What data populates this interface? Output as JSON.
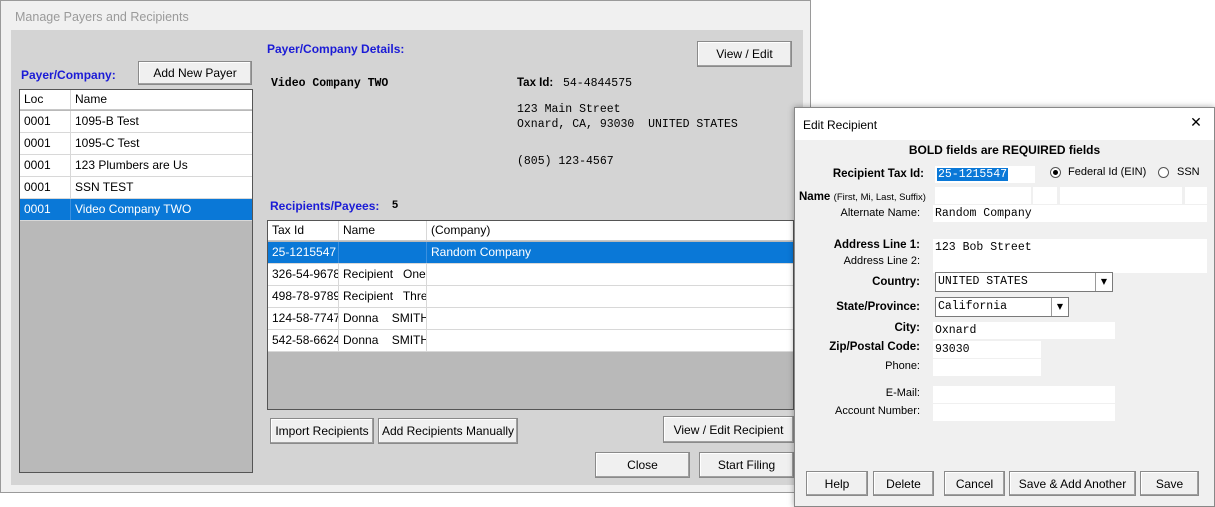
{
  "main": {
    "title": "Manage Payers and Recipients",
    "payer_company_label": "Payer/Company:",
    "add_new_payer": "Add New Payer",
    "payer_columns": [
      "Loc",
      "Name"
    ],
    "payers": [
      {
        "loc": "0001",
        "name": "1095-B Test"
      },
      {
        "loc": "0001",
        "name": "1095-C Test"
      },
      {
        "loc": "0001",
        "name": "123 Plumbers are Us"
      },
      {
        "loc": "0001",
        "name": "SSN TEST"
      },
      {
        "loc": "0001",
        "name": "Video Company TWO"
      }
    ],
    "selected_payer_index": 4,
    "details_label": "Payer/Company Details:",
    "view_edit": "View / Edit",
    "company_name": "Video Company TWO",
    "tax_id_label": "Tax Id:",
    "tax_id_value": "54-4844575",
    "address_line1": "123 Main Street",
    "address_line2": "Oxnard, CA, 93030  UNITED STATES",
    "phone": "(805) 123-4567",
    "recipients_label": "Recipients/Payees:",
    "recipients_count": "5",
    "recipient_columns": [
      "Tax Id",
      "Name",
      "(Company)"
    ],
    "recipients": [
      {
        "tax_id": "25-1215547",
        "name": "",
        "company": "Random Company"
      },
      {
        "tax_id": "326-54-9678",
        "name": "Recipient   One",
        "company": ""
      },
      {
        "tax_id": "498-78-9789",
        "name": "Recipient   Three",
        "company": ""
      },
      {
        "tax_id": "124-58-7747",
        "name": "Donna    SMITH",
        "company": ""
      },
      {
        "tax_id": "542-58-6624",
        "name": "Donna    SMITH",
        "company": ""
      }
    ],
    "selected_recipient_index": 0,
    "import_recipients": "Import Recipients",
    "add_recipients_manually": "Add Recipients Manually",
    "view_edit_recipient": "View / Edit Recipient",
    "close": "Close",
    "start_filing": "Start Filing"
  },
  "dialog": {
    "title": "Edit Recipient",
    "close_glyph": "✕",
    "required_note": "BOLD fields are REQUIRED fields",
    "tax_id_label": "Recipient Tax Id:",
    "tax_id_value": "25-1215547",
    "federal_id_label": "Federal Id (EIN)",
    "ssn_label": "SSN",
    "tin_type": "Federal Id (EIN)",
    "name_label": "Name",
    "name_hint": "(First, Mi, Last, Suffix)",
    "alternate_name_label": "Alternate Name:",
    "alternate_name_value": "Random Company",
    "address1_label": "Address Line 1:",
    "address1_value": "123 Bob Street",
    "address2_label": "Address Line 2:",
    "address2_value": "",
    "country_label": "Country:",
    "country_value": "UNITED STATES",
    "state_label": "State/Province:",
    "state_value": "California",
    "city_label": "City:",
    "city_value": "Oxnard",
    "zip_label": "Zip/Postal Code:",
    "zip_value": "93030",
    "phone_label": "Phone:",
    "phone_value": "",
    "email_label": "E-Mail:",
    "email_value": "",
    "account_label": "Account Number:",
    "account_value": "",
    "buttons": {
      "help": "Help",
      "delete": "Delete",
      "cancel": "Cancel",
      "save_add_another": "Save & Add Another",
      "save": "Save"
    }
  },
  "colors": {
    "selection": "#0a78d7",
    "label_blue": "#1b1bd6",
    "panel": "#d4d4d4"
  }
}
